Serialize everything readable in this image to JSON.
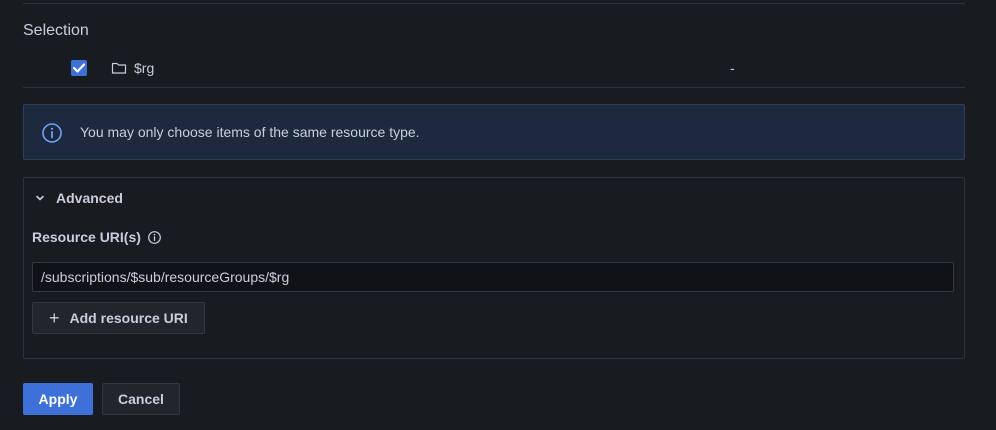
{
  "selection": {
    "title": "Selection",
    "rows": [
      {
        "name": "$rg",
        "value": "-",
        "checked": true,
        "icon": "folder-icon"
      }
    ]
  },
  "info": {
    "icon": "info-circle-icon",
    "text": "You may only choose items of the same resource type."
  },
  "advanced": {
    "toggle_label": "Advanced",
    "expanded": true,
    "uri_label": "Resource URI(s)",
    "uri_value": "/subscriptions/$sub/resourceGroups/$rg",
    "add_label": "Add resource URI"
  },
  "actions": {
    "apply_label": "Apply",
    "cancel_label": "Cancel"
  },
  "colors": {
    "background": "#181b1f",
    "primary": "#3d71d9",
    "info_bg": "#1d2a3d",
    "text": "#ccccdc"
  }
}
